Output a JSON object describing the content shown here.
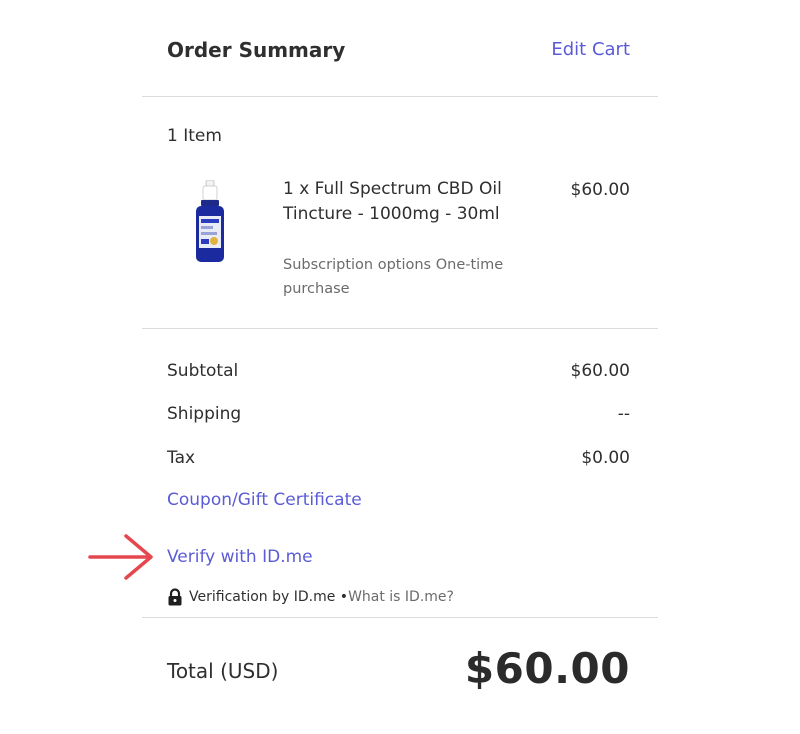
{
  "header": {
    "title": "Order Summary",
    "edit_cart": "Edit Cart"
  },
  "cart": {
    "item_count": "1 Item",
    "item": {
      "name": "1 x Full Spectrum CBD Oil Tincture - 1000mg - 30ml",
      "options": "Subscription options One-time purchase",
      "price": "$60.00"
    }
  },
  "totals": {
    "subtotal_label": "Subtotal",
    "subtotal_value": "$60.00",
    "shipping_label": "Shipping",
    "shipping_value": "--",
    "tax_label": "Tax",
    "tax_value": "$0.00"
  },
  "coupon_link": "Coupon/Gift Certificate",
  "verify": {
    "link": "Verify with ID.me",
    "note": "Verification by ID.me • ",
    "what_link": "What is ID.me?"
  },
  "grand_total": {
    "label": "Total (USD)",
    "value": "$60.00"
  },
  "colors": {
    "link": "#5b5bd6",
    "arrow": "#e5474f",
    "text": "#2f2f2f",
    "divider": "#dcdcdc"
  },
  "icons": {
    "lock": "lock-icon",
    "arrow": "right-arrow-icon",
    "product": "tincture-bottle-image"
  }
}
